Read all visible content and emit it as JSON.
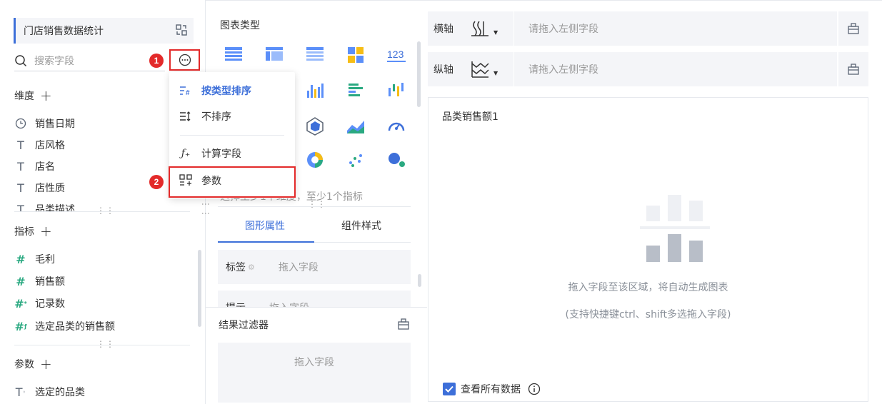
{
  "left_panel": {
    "dataset_name": "门店销售数据统计",
    "search_placeholder": "搜索字段",
    "dimensions_label": "维度",
    "dimensions": [
      "销售日期",
      "店风格",
      "店名",
      "店性质",
      "品类描述"
    ],
    "measures_label": "指标",
    "measures": [
      "毛利",
      "销售额",
      "记录数",
      "选定品类的销售额"
    ],
    "params_label": "参数",
    "params": [
      "选定的品类"
    ],
    "badge1": "1",
    "badge2": "2",
    "dots": "⋮⋮"
  },
  "menu": {
    "items": [
      "按类型排序",
      "不排序",
      "计算字段",
      "参数"
    ]
  },
  "middle_panel": {
    "chart_type_title": "图表类型",
    "hint": "选择至少1个维度，至少1个指标",
    "tabs": [
      "图形属性",
      "组件样式"
    ],
    "label_row": {
      "name": "标签",
      "placeholder": "拖入字段"
    },
    "tip_row": {
      "name": "提示",
      "placeholder": "拖入字段"
    },
    "filter_title": "结果过滤器",
    "filter_placeholder": "拖入字段"
  },
  "right_panel": {
    "x_axis": {
      "label": "横轴",
      "placeholder": "请拖入左侧字段"
    },
    "y_axis": {
      "label": "纵轴",
      "placeholder": "请拖入左侧字段"
    },
    "chart_title": "品类销售额1",
    "empty_text": "拖入字段至该区域，将自动生成图表",
    "empty_subtext": "(支持快捷键ctrl、shift多选拖入字段)",
    "show_all_label": "查看所有数据"
  },
  "colors": {
    "accent": "#3d6fd9",
    "highlight": "#e32a2a",
    "measure": "#2aa981"
  }
}
